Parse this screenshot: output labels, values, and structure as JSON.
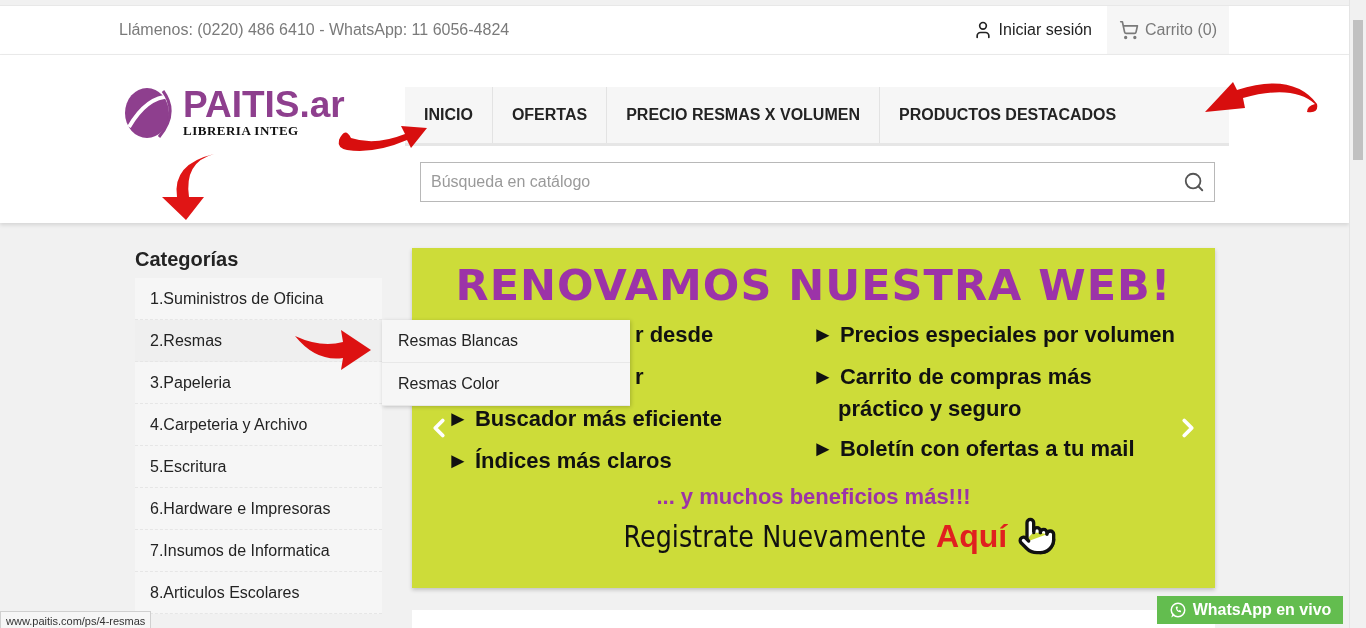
{
  "top_bar": {
    "contact": "Llámenos: (0220) 486 6410 - WhatsApp: 11 6056-4824",
    "login": "Iniciar sesión",
    "cart": "Carrito (0)"
  },
  "logo": {
    "name": "PAITIS.ar",
    "tagline": "LIBRERIA INTEG"
  },
  "nav": [
    {
      "label": "INICIO"
    },
    {
      "label": "OFERTAS"
    },
    {
      "label": "PRECIO RESMAS X VOLUMEN"
    },
    {
      "label": "PRODUCTOS DESTACADOS"
    }
  ],
  "search": {
    "placeholder": "Búsqueda en catálogo"
  },
  "sidebar": {
    "title": "Categorías",
    "items": [
      {
        "label": "1.Suministros de Oficina",
        "expanded": false
      },
      {
        "label": "2.Resmas",
        "expanded": true,
        "children": [
          {
            "label": "Resmas Blancas"
          },
          {
            "label": "Resmas Color"
          }
        ]
      },
      {
        "label": "3.Papeleria",
        "expanded": false
      },
      {
        "label": "4.Carpeteria y Archivo",
        "expanded": false
      },
      {
        "label": "5.Escritura",
        "expanded": false
      },
      {
        "label": "6.Hardware e Impresoras",
        "expanded": false
      },
      {
        "label": "7.Insumos de Informatica",
        "expanded": false
      },
      {
        "label": "8.Articulos Escolares",
        "expanded": false
      }
    ]
  },
  "banner": {
    "title": "RENOVAMOS NUESTRA WEB!",
    "left_features": [
      {
        "text": "r desde"
      },
      {
        "text": "r"
      },
      {
        "bullet": "►",
        "text": "Buscador más eficiente"
      },
      {
        "bullet": "►",
        "text": "Índices más claros"
      }
    ],
    "right_features": [
      {
        "bullet": "►",
        "text": "Precios especiales por volumen"
      },
      {
        "bullet": "►",
        "text": "Carrito de compras más",
        "continuation": "práctico y seguro"
      },
      {
        "bullet": "►",
        "text": "Boletín con ofertas a tu mail"
      }
    ],
    "subtitle": "... y muchos beneficios más!!!",
    "cta": "Registrate Nuevamente",
    "cta_highlight": "Aquí"
  },
  "status_url": "www.paitis.com/ps/4-resmas",
  "whatsapp_button": "WhatsApp en vivo"
}
